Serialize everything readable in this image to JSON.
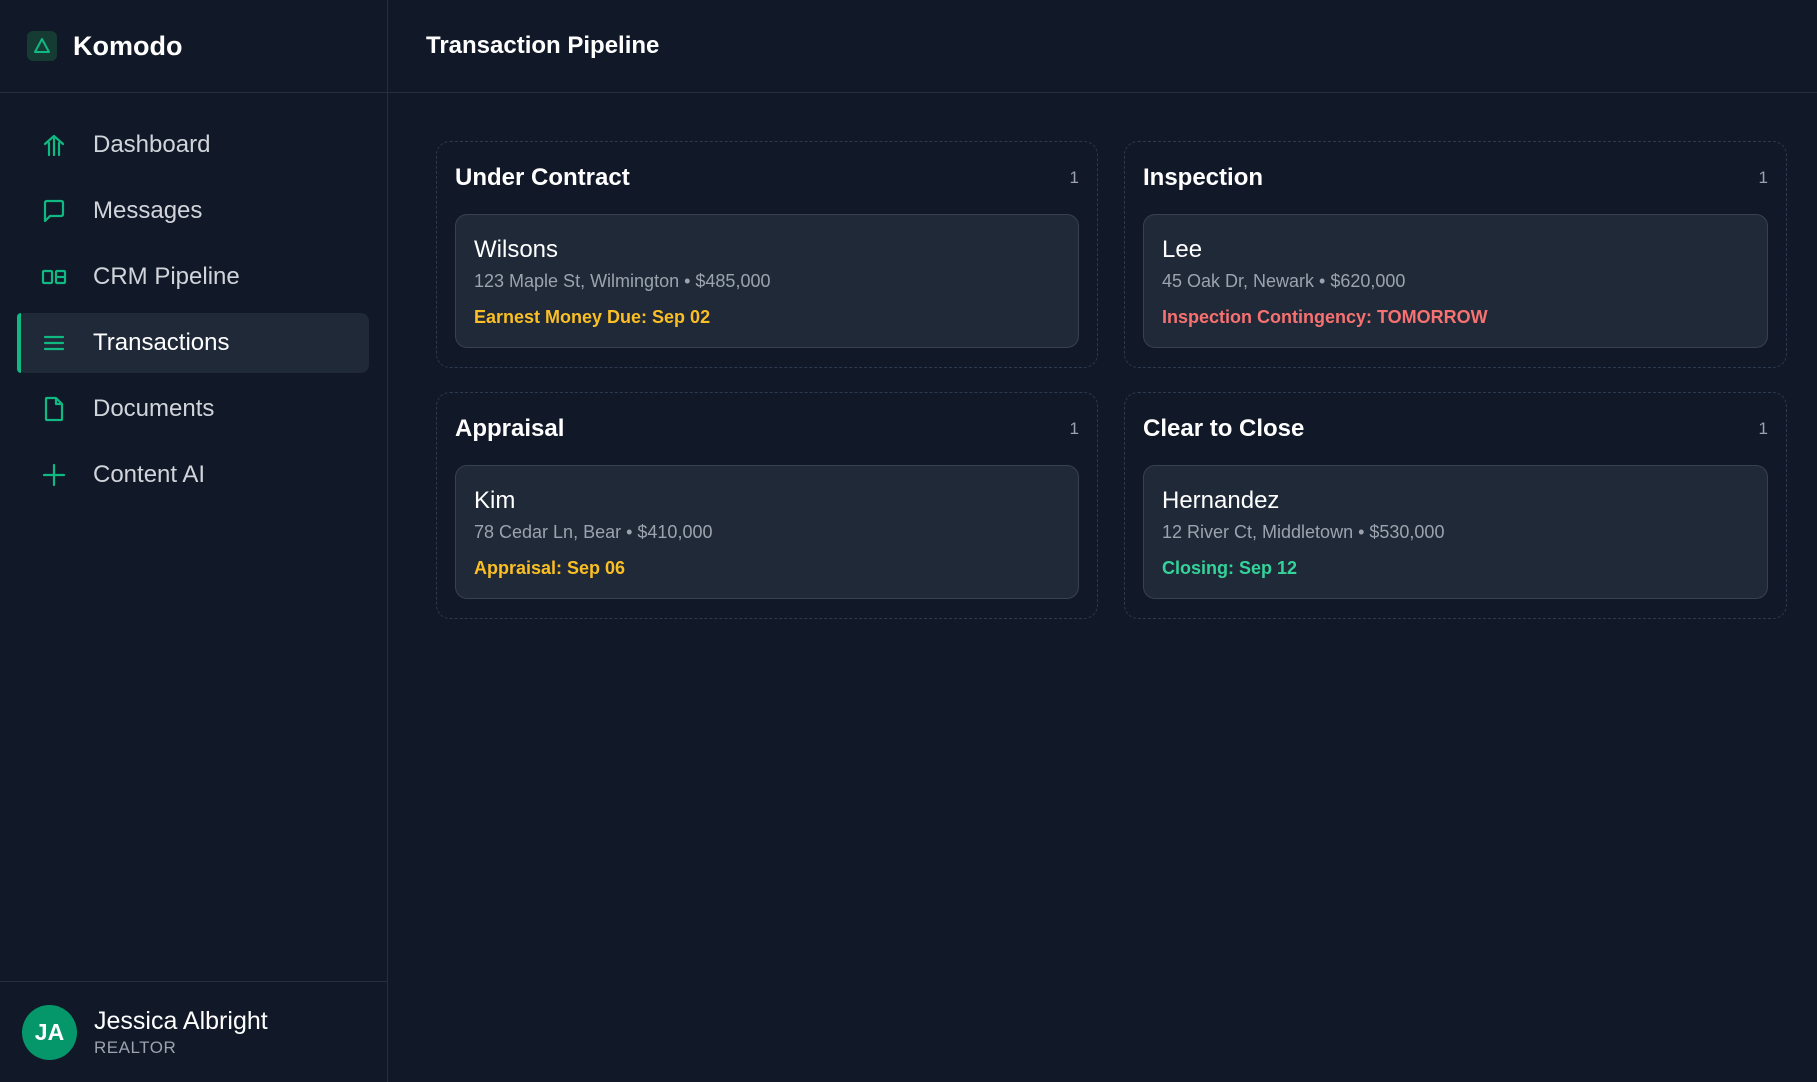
{
  "app": {
    "name": "Komodo"
  },
  "colors": {
    "accent": "#10b981",
    "warning": "#fbbf24",
    "danger": "#f87171",
    "success": "#34d399"
  },
  "sidebar": {
    "items": [
      {
        "label": "Dashboard",
        "icon": "dashboard-arrow-icon",
        "active": false
      },
      {
        "label": "Messages",
        "icon": "chat-bubble-icon",
        "active": false
      },
      {
        "label": "CRM Pipeline",
        "icon": "pipeline-icon",
        "active": false
      },
      {
        "label": "Transactions",
        "icon": "list-icon",
        "active": true
      },
      {
        "label": "Documents",
        "icon": "document-icon",
        "active": false
      },
      {
        "label": "Content AI",
        "icon": "plus-icon",
        "active": false
      }
    ]
  },
  "user": {
    "initials": "JA",
    "name": "Jessica Albright",
    "role": "REALTOR"
  },
  "header": {
    "title": "Transaction Pipeline"
  },
  "columns": [
    {
      "title": "Under Contract",
      "count": "1",
      "card": {
        "name": "Wilsons",
        "meta": "123 Maple St, Wilmington • $485,000",
        "deadline": "Earnest Money Due: Sep 02",
        "deadline_color": "#fbbf24"
      }
    },
    {
      "title": "Inspection",
      "count": "1",
      "card": {
        "name": "Lee",
        "meta": "45 Oak Dr, Newark • $620,000",
        "deadline": "Inspection Contingency: TOMORROW",
        "deadline_color": "#f87171"
      }
    },
    {
      "title": "Appraisal",
      "count": "1",
      "card": {
        "name": "Kim",
        "meta": "78 Cedar Ln, Bear • $410,000",
        "deadline": "Appraisal: Sep 06",
        "deadline_color": "#fbbf24"
      }
    },
    {
      "title": "Clear to Close",
      "count": "1",
      "card": {
        "name": "Hernandez",
        "meta": "12 River Ct, Middletown • $530,000",
        "deadline": "Closing: Sep 12",
        "deadline_color": "#34d399"
      }
    }
  ]
}
